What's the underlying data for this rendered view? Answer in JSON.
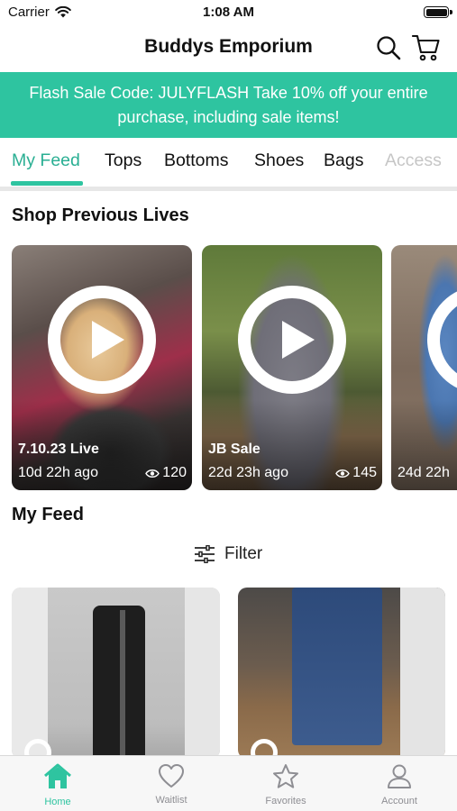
{
  "status_bar": {
    "carrier": "Carrier",
    "time": "1:08 AM"
  },
  "header": {
    "title": "Buddys Emporium"
  },
  "banner": {
    "text": "Flash Sale Code: JULYFLASH Take 10% off your entire purchase, including sale items!"
  },
  "tabs": [
    {
      "label": "My Feed",
      "active": true
    },
    {
      "label": "Tops"
    },
    {
      "label": "Bottoms"
    },
    {
      "label": "Shoes"
    },
    {
      "label": "Bags"
    },
    {
      "label": "Access"
    }
  ],
  "lives_section": {
    "title": "Shop Previous Lives"
  },
  "lives": [
    {
      "title": "7.10.23 Live",
      "ago": "10d 22h ago",
      "views": "120"
    },
    {
      "title": "JB Sale",
      "ago": "22d 23h ago",
      "views": "145"
    },
    {
      "title": "",
      "ago": "24d 22h",
      "views": ""
    }
  ],
  "feed_section": {
    "title": "My Feed",
    "filter_label": "Filter"
  },
  "tabbar": [
    {
      "label": "Home",
      "icon": "home-icon",
      "active": true
    },
    {
      "label": "Waitlist",
      "icon": "heart-icon"
    },
    {
      "label": "Favorites",
      "icon": "star-icon"
    },
    {
      "label": "Account",
      "icon": "person-icon"
    }
  ],
  "colors": {
    "accent": "#2ec4a0",
    "accent_text": "#2aaf93",
    "tab_inactive": "#8e8e93"
  }
}
